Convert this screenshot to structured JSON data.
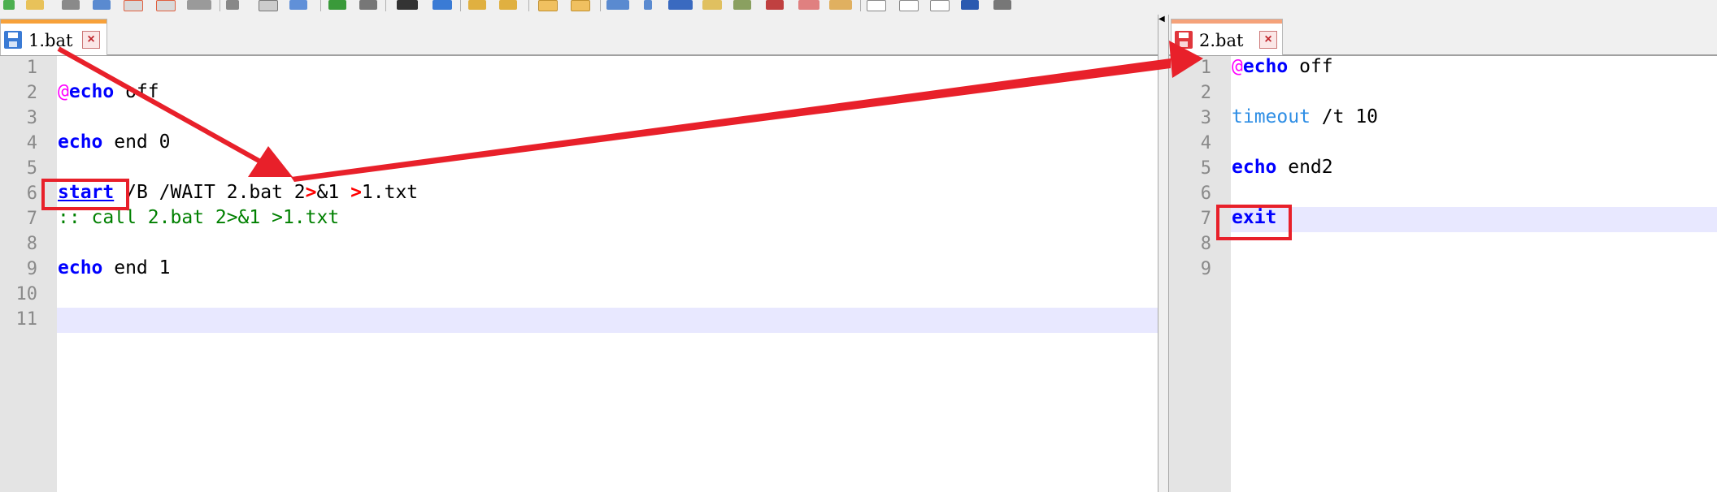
{
  "colors": {
    "keyword": "#0000ff",
    "at_sign": "#ff00ff",
    "redirect": "#ff0000",
    "comment": "#008000",
    "timeout": "#2e8ee5",
    "current_line": "#e8e8ff",
    "annotation": "#e8202a",
    "active_tab_accent": "#f7a13a"
  },
  "left_pane": {
    "tab": {
      "label": "1.bat",
      "save_icon": "floppy-disk-icon",
      "save_color": "#3a7bd5",
      "close_icon": "close-icon"
    },
    "line_numbers": [
      "1",
      "2",
      "3",
      "4",
      "5",
      "6",
      "7",
      "8",
      "9",
      "10",
      "11"
    ],
    "lines": {
      "l2_at": "@",
      "l2_cmd": "echo",
      "l2_rest": " off",
      "l4_cmd": "echo",
      "l4_rest": " end 0",
      "l6_cmd": "start",
      "l6_a": " /B /WAIT 2.bat 2",
      "l6_r1": ">",
      "l6_b": "&1 ",
      "l6_r2": ">",
      "l6_c": "1.txt",
      "l7_comment": ":: call 2.bat 2>&1 >1.txt",
      "l9_cmd": "echo",
      "l9_rest": " end 1"
    },
    "current_line": 11
  },
  "right_pane": {
    "tab": {
      "label": "2.bat",
      "save_icon": "floppy-disk-icon",
      "save_color": "#e0363c",
      "close_icon": "close-icon"
    },
    "line_numbers": [
      "1",
      "2",
      "3",
      "4",
      "5",
      "6",
      "7",
      "8",
      "9"
    ],
    "lines": {
      "l1_at": "@",
      "l1_cmd": "echo",
      "l1_rest": " off",
      "l3_cmd": "timeout",
      "l3_rest": " /t 10",
      "l5_cmd": "echo",
      "l5_rest": " end2",
      "l7_cmd": "exit"
    },
    "current_line": 7
  },
  "toolbar": {
    "icons": [
      "new-file-icon",
      "open-folder-icon",
      "save-icon",
      "save-all-icon",
      "close-icon",
      "close-all-icon",
      "print-icon",
      "cut-icon",
      "copy-icon",
      "paste-icon",
      "undo-icon",
      "redo-icon",
      "find-icon",
      "replace-icon",
      "zoom-in-icon",
      "zoom-out-icon",
      "sync-v-icon",
      "sync-h-icon",
      "wrap-icon",
      "indent-icon",
      "all-chars-icon",
      "fold-icon",
      "doc-map-icon",
      "function-list-icon",
      "record-macro-icon",
      "stop-macro-icon",
      "play-macro-icon",
      "run-macro-icon",
      "save-macro-icon"
    ]
  }
}
